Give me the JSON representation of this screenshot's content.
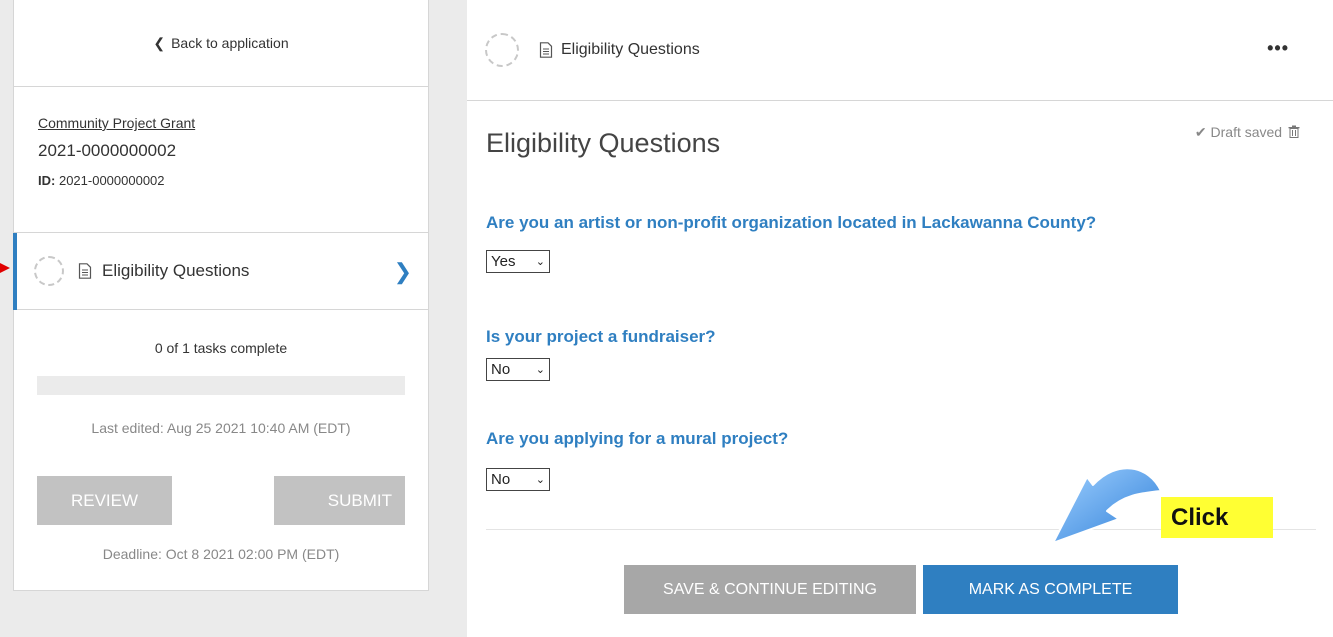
{
  "left": {
    "back_label": "Back to application",
    "grant_name": "Community Project Grant",
    "grant_code": "2021-0000000002",
    "id_label": "ID:",
    "id_value": "2021-0000000002",
    "task": {
      "label": "Eligibility Questions"
    },
    "progress_text": "0 of 1 tasks complete",
    "progress_fraction": 0,
    "last_edited": "Last edited: Aug 25 2021 10:40 AM (EDT)",
    "review_label": "REVIEW",
    "submit_label": "SUBMIT",
    "deadline": "Deadline: Oct 8 2021 02:00 PM (EDT)"
  },
  "right": {
    "header_label": "Eligibility Questions",
    "more_label": "•••",
    "form_title": "Eligibility Questions",
    "draft_status": "✔ Draft saved",
    "questions": [
      {
        "text": "Are you an artist or non-profit organization located in Lackawanna County?",
        "answer": "Yes"
      },
      {
        "text": "Is your project a fundraiser?",
        "answer": "No"
      },
      {
        "text": "Are you applying for a mural project?",
        "answer": "No"
      }
    ],
    "save_label": "SAVE & CONTINUE EDITING",
    "complete_label": "MARK AS COMPLETE"
  },
  "annotation": {
    "click_label": "Click",
    "highlight_color": "#ffff33",
    "arrow_color": "#3a8ee6",
    "pointer_color": "#e00000"
  },
  "colors": {
    "accent": "#2f7fc1",
    "button_disabled": "#c2c2c2"
  }
}
